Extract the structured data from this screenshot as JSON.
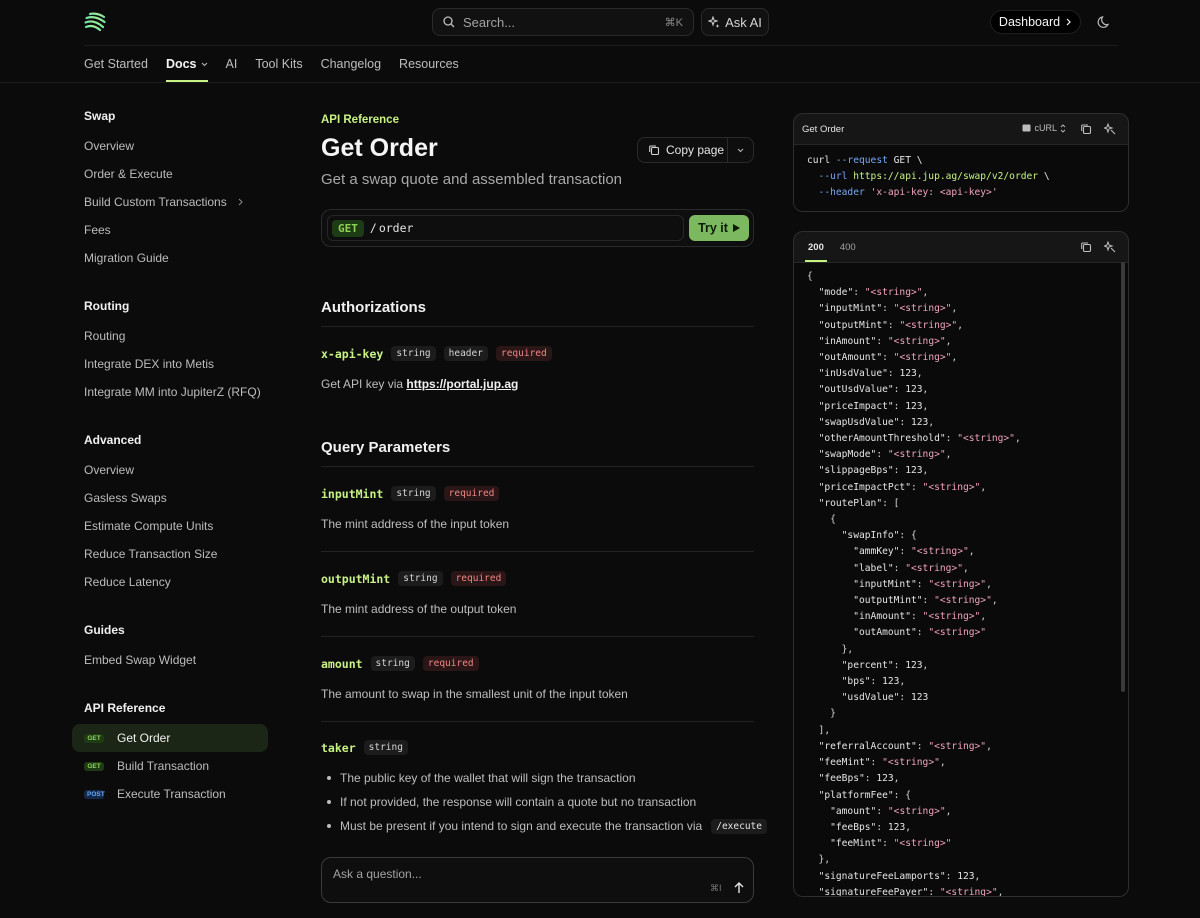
{
  "header": {
    "search_placeholder": "Search...",
    "search_shortcut": "⌘K",
    "ask_ai_label": "Ask AI",
    "dashboard_label": "Dashboard"
  },
  "nav": {
    "tabs": [
      {
        "label": "Get Started"
      },
      {
        "label": "Docs",
        "active": true
      },
      {
        "label": "AI"
      },
      {
        "label": "Tool Kits"
      },
      {
        "label": "Changelog"
      },
      {
        "label": "Resources"
      }
    ]
  },
  "sidebar": {
    "groups": [
      {
        "title": "Swap",
        "items": [
          "Overview",
          "Order & Execute",
          "Build Custom Transactions",
          "Fees",
          "Migration Guide"
        ]
      },
      {
        "title": "Routing",
        "items": [
          "Routing",
          "Integrate DEX into Metis",
          "Integrate MM into JupiterZ (RFQ)"
        ]
      },
      {
        "title": "Advanced",
        "items": [
          "Overview",
          "Gasless Swaps",
          "Estimate Compute Units",
          "Reduce Transaction Size",
          "Reduce Latency"
        ]
      },
      {
        "title": "Guides",
        "items": [
          "Embed Swap Widget"
        ]
      },
      {
        "title": "API Reference",
        "items": [
          {
            "badge": "GET",
            "label": "Get Order"
          },
          {
            "badge": "GET",
            "label": "Build Transaction"
          },
          {
            "badge": "POST",
            "label": "Execute Transaction"
          }
        ]
      }
    ]
  },
  "main": {
    "breadcrumb": "API Reference",
    "title": "Get Order",
    "subtitle": "Get a swap quote and assembled transaction",
    "copy_page_label": "Copy page",
    "endpoint": {
      "method": "GET",
      "slash": "/",
      "path": "order",
      "try_label": "Try it"
    },
    "authorizations": {
      "heading": "Authorizations",
      "param": {
        "name": "x-api-key",
        "type": "string",
        "location": "header",
        "required": "required"
      },
      "desc_prefix": "Get API key via ",
      "desc_link": "https://portal.jup.ag"
    },
    "query": {
      "heading": "Query Parameters",
      "params": [
        {
          "name": "inputMint",
          "type": "string",
          "required": "required",
          "desc": "The mint address of the input token"
        },
        {
          "name": "outputMint",
          "type": "string",
          "required": "required",
          "desc": "The mint address of the output token"
        },
        {
          "name": "amount",
          "type": "string",
          "required": "required",
          "desc": "The amount to swap in the smallest unit of the input token"
        },
        {
          "name": "taker",
          "type": "string"
        }
      ],
      "taker_bullets": [
        "The public key of the wallet that will sign the transaction",
        "If not provided, the response will contain a quote but no transaction",
        "Must be present if you intend to sign and execute the transaction via"
      ],
      "taker_code": "/execute"
    },
    "ask": {
      "placeholder": "Ask a question...",
      "shortcut": "⌘I"
    }
  },
  "request_panel": {
    "title": "Get Order",
    "lang": "cURL",
    "lines": [
      [
        "curl",
        " --request",
        " GET",
        " \\"
      ],
      [
        "  --url",
        " https://api.jup.ag/swap/v2/order",
        " \\"
      ],
      [
        "  --header",
        " 'x-api-key: <api-key>'"
      ]
    ]
  },
  "response_panel": {
    "tabs": [
      "200",
      "400"
    ],
    "json_lines": [
      "{",
      "  \"mode\": \"<string>\",",
      "  \"inputMint\": \"<string>\",",
      "  \"outputMint\": \"<string>\",",
      "  \"inAmount\": \"<string>\",",
      "  \"outAmount\": \"<string>\",",
      "  \"inUsdValue\": 123,",
      "  \"outUsdValue\": 123,",
      "  \"priceImpact\": 123,",
      "  \"swapUsdValue\": 123,",
      "  \"otherAmountThreshold\": \"<string>\",",
      "  \"swapMode\": \"<string>\",",
      "  \"slippageBps\": 123,",
      "  \"priceImpactPct\": \"<string>\",",
      "  \"routePlan\": [",
      "    {",
      "      \"swapInfo\": {",
      "        \"ammKey\": \"<string>\",",
      "        \"label\": \"<string>\",",
      "        \"inputMint\": \"<string>\",",
      "        \"outputMint\": \"<string>\",",
      "        \"inAmount\": \"<string>\",",
      "        \"outAmount\": \"<string>\"",
      "      },",
      "      \"percent\": 123,",
      "      \"bps\": 123,",
      "      \"usdValue\": 123",
      "    }",
      "  ],",
      "  \"referralAccount\": \"<string>\",",
      "  \"feeMint\": \"<string>\",",
      "  \"feeBps\": 123,",
      "  \"platformFee\": {",
      "    \"amount\": \"<string>\",",
      "    \"feeBps\": 123,",
      "    \"feeMint\": \"<string>\"",
      "  },",
      "  \"signatureFeeLamports\": 123,",
      "  \"signatureFeePayer\": \"<string>\","
    ]
  }
}
